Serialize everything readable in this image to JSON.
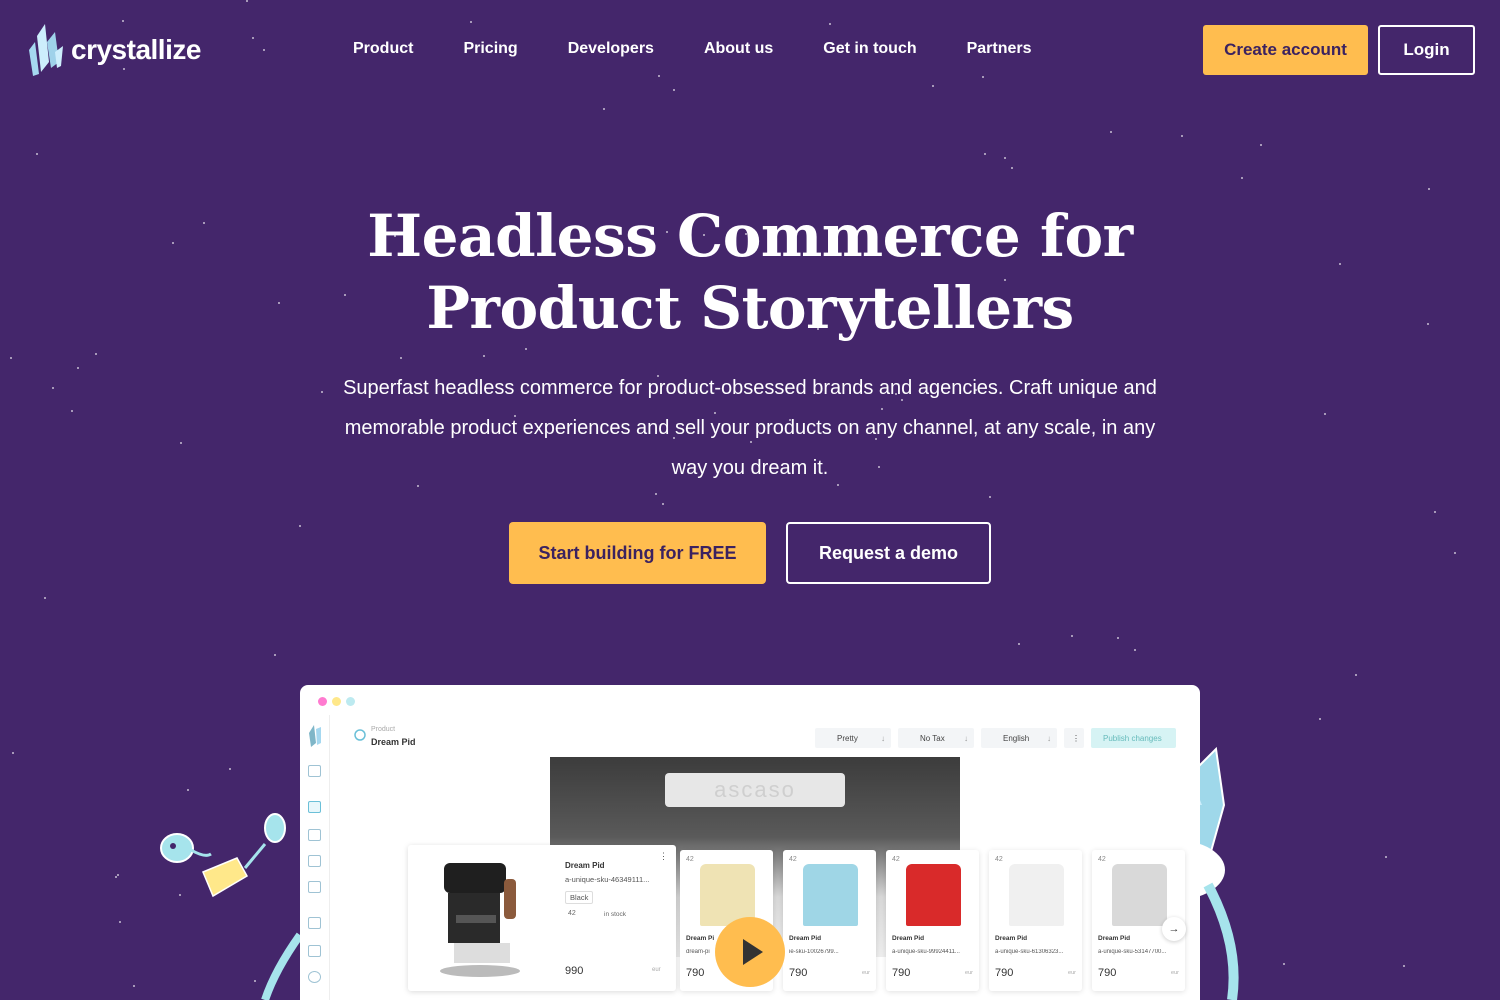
{
  "brand": {
    "name": "crystallize"
  },
  "nav": {
    "links": [
      "Product",
      "Pricing",
      "Developers",
      "About us",
      "Get in touch",
      "Partners"
    ],
    "create_account": "Create account",
    "login": "Login"
  },
  "hero": {
    "title_line1": "Headless Commerce for",
    "title_line2": "Product Storytellers",
    "subtitle": "Superfast headless commerce for product-obsessed brands and agencies. Craft unique and memorable product experiences and sell your products on any channel, at any scale, in any way you dream it.",
    "cta_primary": "Start building for FREE",
    "cta_secondary": "Request a demo"
  },
  "colors": {
    "background": "#44266b",
    "accent": "#ffbd4f"
  },
  "mockup": {
    "breadcrumb_type": "Product",
    "breadcrumb_name": "Dream Pid",
    "toolbar": {
      "pretty": "Pretty",
      "tax": "No Tax",
      "language": "English",
      "publish": "Publish changes"
    },
    "brand_plate": "ascaso",
    "main_card": {
      "name": "Dream Pid",
      "sku": "a-unique-sku-46349111...",
      "variant": "Black",
      "stock": "42",
      "stock_label": "in stock",
      "price": "990",
      "currency": "eur"
    },
    "cards": [
      {
        "badge": "42",
        "name": "Dream Pi",
        "sku": "dream-pi",
        "price": "790",
        "color": "#efe3b4"
      },
      {
        "badge": "42",
        "name": "Dream Pid",
        "sku": "ie-sku-10026799...",
        "price": "790",
        "currency": "eur",
        "color": "#9fd6e6"
      },
      {
        "badge": "42",
        "name": "Dream Pid",
        "sku": "a-unique-sku-99924411...",
        "price": "790",
        "currency": "eur",
        "color": "#d92a2a"
      },
      {
        "badge": "42",
        "name": "Dream Pid",
        "sku": "a-unique-sku-61306323...",
        "price": "790",
        "currency": "eur",
        "color": "#f0f0f0"
      },
      {
        "badge": "42",
        "name": "Dream Pid",
        "sku": "a-unique-sku-53147700...",
        "price": "790",
        "currency": "eur",
        "color": "#d9d9d9"
      }
    ]
  }
}
